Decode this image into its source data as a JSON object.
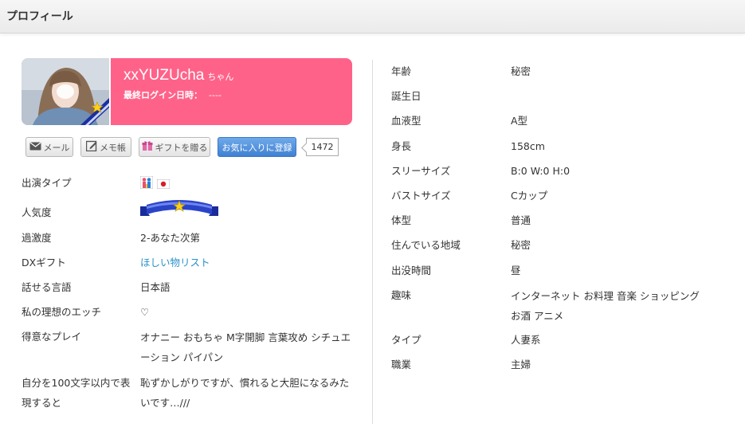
{
  "header": {
    "title": "プロフィール"
  },
  "profile": {
    "name": "xxYUZUcha",
    "honorific": "ちゃん",
    "last_login_label": "最終ログイン日時：",
    "last_login_value": "----"
  },
  "buttons": {
    "mail": "メール",
    "memo": "メモ帳",
    "gift": "ギフトを贈る",
    "favorite": "お気に入りに登録",
    "favorite_count": "1472"
  },
  "left_info": [
    {
      "label": "出演タイプ",
      "value": ""
    },
    {
      "label": "人気度",
      "value": ""
    },
    {
      "label": "過激度",
      "value": "2-あなた次第"
    },
    {
      "label": "DXギフト",
      "value": "ほしい物リスト"
    },
    {
      "label": "話せる言語",
      "value": "日本語"
    },
    {
      "label": "私の理想のエッチ",
      "value": "♡"
    },
    {
      "label": "得意なプレイ",
      "value": "オナニー おもちゃ M字開脚 言葉攻め シチュエ ーション パイパン"
    },
    {
      "label": "自分を100文字以内で表現すると",
      "value": "恥ずかしがりですが、慣れると大胆になるみたいです…///"
    }
  ],
  "right_info": [
    {
      "label": "年齢",
      "value": "秘密"
    },
    {
      "label": "誕生日",
      "value": ""
    },
    {
      "label": "血液型",
      "value": "A型"
    },
    {
      "label": "身長",
      "value": "158cm"
    },
    {
      "label": "スリーサイズ",
      "value": "B:0 W:0 H:0"
    },
    {
      "label": "バストサイズ",
      "value": "Cカップ"
    },
    {
      "label": "体型",
      "value": "普通"
    },
    {
      "label": "住んでいる地域",
      "value": "秘密"
    },
    {
      "label": "出没時間",
      "value": "昼"
    },
    {
      "label": "趣味",
      "value": "インターネット お料理 音楽 ショッピング お酒 アニメ"
    },
    {
      "label": "タイプ",
      "value": "人妻系"
    },
    {
      "label": "職業",
      "value": "主婦"
    }
  ],
  "icons": {
    "mail": "mail-icon",
    "memo": "memo-icon",
    "gift": "gift-icon",
    "appearance_types": [
      "couple-icon",
      "japan-flag-icon"
    ],
    "popularity": "star-ribbon-icon"
  },
  "colors": {
    "accent_pink": "#ff6289",
    "favorite_blue": "#4a8ad8",
    "link_blue": "#2a91c9"
  }
}
